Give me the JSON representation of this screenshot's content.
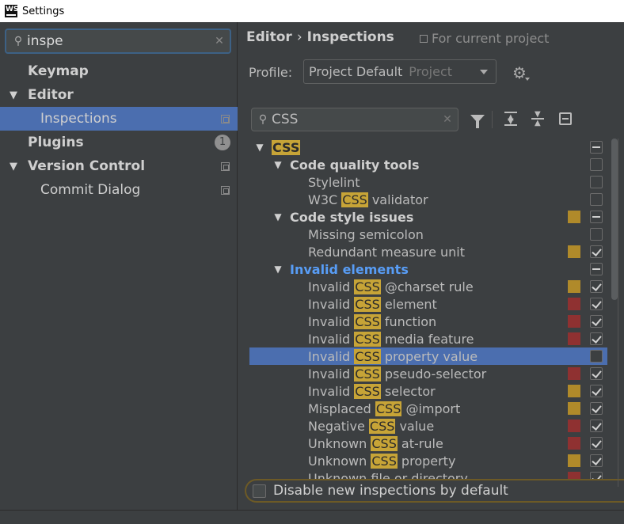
{
  "window": {
    "title": "Settings",
    "logo": "WS"
  },
  "sidebar": {
    "search": {
      "value": "inspe",
      "icon": "search-icon",
      "clear_icon": "clear-icon"
    },
    "items": [
      {
        "label": "Keymap",
        "level": 0,
        "bold": true,
        "arrow": "",
        "selected": false
      },
      {
        "label": "Editor",
        "level": 0,
        "bold": true,
        "arrow": "▼",
        "selected": false
      },
      {
        "label": "Inspections",
        "level": 1,
        "bold": false,
        "arrow": "",
        "selected": true,
        "icon": "copy-icon"
      },
      {
        "label": "Plugins",
        "level": 0,
        "bold": true,
        "arrow": "",
        "selected": false,
        "badge": "1"
      },
      {
        "label": "Version Control",
        "level": 0,
        "bold": true,
        "arrow": "▼",
        "selected": false,
        "icon": "copy-icon"
      },
      {
        "label": "Commit Dialog",
        "level": 1,
        "bold": false,
        "arrow": "",
        "selected": false,
        "icon": "copy-icon"
      }
    ]
  },
  "header": {
    "breadcrumb": [
      "Editor",
      "Inspections"
    ],
    "breadcrumb_sep": "›",
    "scope": "For current project"
  },
  "profile": {
    "label": "Profile:",
    "value": "Project Default",
    "scope": "Project"
  },
  "filter": {
    "value": "CSS"
  },
  "colors": {
    "warning": "#b08a2a",
    "error": "#8f3131",
    "highlight": "#c7a437",
    "selection": "#4b6eaf",
    "group_blue": "#589df6"
  },
  "inspections": [
    {
      "parts": [
        {
          "t": "CSS",
          "hl": true
        }
      ],
      "level": 0,
      "group": true,
      "arrow": "▼",
      "sev": "",
      "cb": "partial"
    },
    {
      "parts": [
        {
          "t": "Code quality tools",
          "hl": false
        }
      ],
      "level": 1,
      "group": true,
      "arrow": "▼",
      "sev": "",
      "cb": "empty"
    },
    {
      "parts": [
        {
          "t": "Stylelint",
          "hl": false
        }
      ],
      "level": 2,
      "sev": "",
      "cb": "empty"
    },
    {
      "parts": [
        {
          "t": "W3C ",
          "hl": false
        },
        {
          "t": "CSS",
          "hl": true
        },
        {
          "t": " validator",
          "hl": false
        }
      ],
      "level": 2,
      "sev": "",
      "cb": "empty"
    },
    {
      "parts": [
        {
          "t": "Code style issues",
          "hl": false
        }
      ],
      "level": 1,
      "group": true,
      "arrow": "▼",
      "sev": "warn",
      "cb": "partial"
    },
    {
      "parts": [
        {
          "t": "Missing semicolon",
          "hl": false
        }
      ],
      "level": 2,
      "sev": "",
      "cb": "empty"
    },
    {
      "parts": [
        {
          "t": "Redundant measure unit",
          "hl": false
        }
      ],
      "level": 2,
      "sev": "warn",
      "cb": "checked"
    },
    {
      "parts": [
        {
          "t": "Invalid elements",
          "hl": false
        }
      ],
      "level": 1,
      "group": true,
      "blue": true,
      "arrow": "▼",
      "sev": "",
      "cb": "partial"
    },
    {
      "parts": [
        {
          "t": "Invalid ",
          "hl": false
        },
        {
          "t": "CSS",
          "hl": true
        },
        {
          "t": " @charset rule",
          "hl": false
        }
      ],
      "level": 2,
      "sev": "warn",
      "cb": "checked"
    },
    {
      "parts": [
        {
          "t": "Invalid ",
          "hl": false
        },
        {
          "t": "CSS",
          "hl": true
        },
        {
          "t": " element",
          "hl": false
        }
      ],
      "level": 2,
      "sev": "err",
      "cb": "checked"
    },
    {
      "parts": [
        {
          "t": "Invalid ",
          "hl": false
        },
        {
          "t": "CSS",
          "hl": true
        },
        {
          "t": " function",
          "hl": false
        }
      ],
      "level": 2,
      "sev": "err",
      "cb": "checked"
    },
    {
      "parts": [
        {
          "t": "Invalid ",
          "hl": false
        },
        {
          "t": "CSS",
          "hl": true
        },
        {
          "t": " media feature",
          "hl": false
        }
      ],
      "level": 2,
      "sev": "err",
      "cb": "checked"
    },
    {
      "parts": [
        {
          "t": "Invalid ",
          "hl": false
        },
        {
          "t": "CSS",
          "hl": true
        },
        {
          "t": " property value",
          "hl": false
        }
      ],
      "level": 2,
      "sev": "",
      "cb": "empty",
      "selected": true
    },
    {
      "parts": [
        {
          "t": "Invalid ",
          "hl": false
        },
        {
          "t": "CSS",
          "hl": true
        },
        {
          "t": " pseudo-selector",
          "hl": false
        }
      ],
      "level": 2,
      "sev": "err",
      "cb": "checked"
    },
    {
      "parts": [
        {
          "t": "Invalid ",
          "hl": false
        },
        {
          "t": "CSS",
          "hl": true
        },
        {
          "t": " selector",
          "hl": false
        }
      ],
      "level": 2,
      "sev": "warn",
      "cb": "checked"
    },
    {
      "parts": [
        {
          "t": "Misplaced ",
          "hl": false
        },
        {
          "t": "CSS",
          "hl": true
        },
        {
          "t": " @import",
          "hl": false
        }
      ],
      "level": 2,
      "sev": "warn",
      "cb": "checked"
    },
    {
      "parts": [
        {
          "t": "Negative ",
          "hl": false
        },
        {
          "t": "CSS",
          "hl": true
        },
        {
          "t": " value",
          "hl": false
        }
      ],
      "level": 2,
      "sev": "err",
      "cb": "checked"
    },
    {
      "parts": [
        {
          "t": "Unknown ",
          "hl": false
        },
        {
          "t": "CSS",
          "hl": true
        },
        {
          "t": " at-rule",
          "hl": false
        }
      ],
      "level": 2,
      "sev": "err",
      "cb": "checked"
    },
    {
      "parts": [
        {
          "t": "Unknown ",
          "hl": false
        },
        {
          "t": "CSS",
          "hl": true
        },
        {
          "t": " property",
          "hl": false
        }
      ],
      "level": 2,
      "sev": "warn",
      "cb": "checked"
    },
    {
      "parts": [
        {
          "t": "Unknown file or directory",
          "hl": false
        }
      ],
      "level": 2,
      "sev": "err",
      "cb": "checked"
    }
  ],
  "footer": {
    "disable_new_label": "Disable new inspections by default"
  }
}
